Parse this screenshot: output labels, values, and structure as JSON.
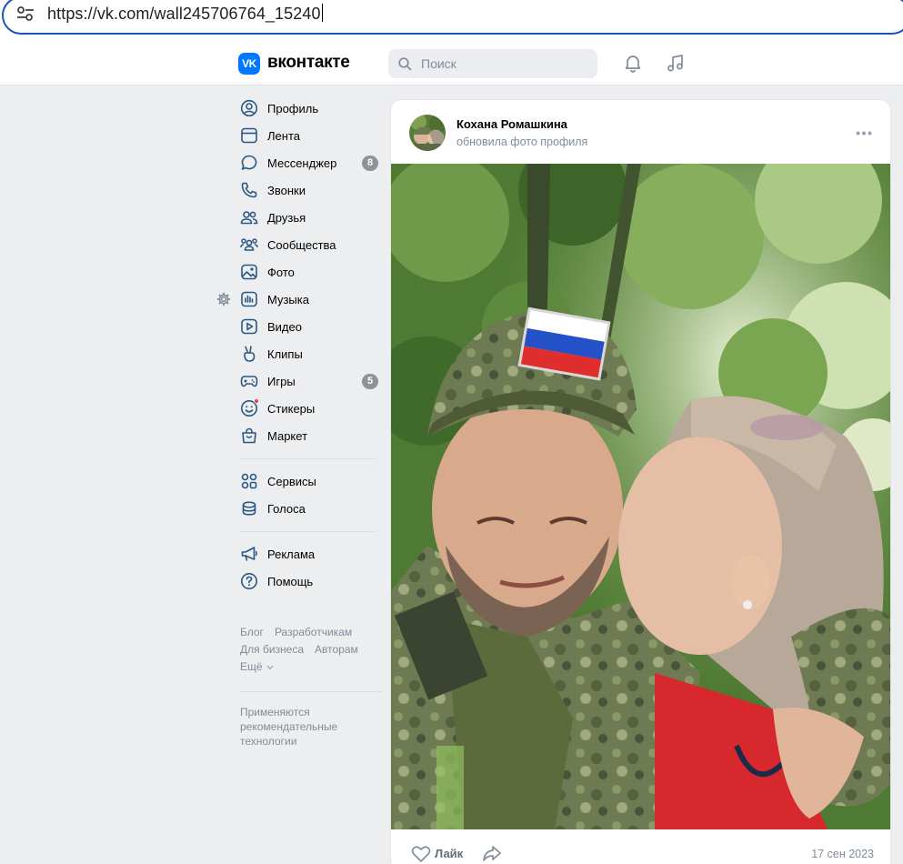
{
  "browser": {
    "url": "https://vk.com/wall245706764_15240"
  },
  "header": {
    "logo_badge": "VK",
    "logo_text": "вконтакте",
    "search_placeholder": "Поиск"
  },
  "sidebar": {
    "items": [
      {
        "label": "Профиль",
        "icon": "profile-icon"
      },
      {
        "label": "Лента",
        "icon": "news-icon"
      },
      {
        "label": "Мессенджер",
        "icon": "messenger-icon",
        "badge": "8"
      },
      {
        "label": "Звонки",
        "icon": "phone-icon"
      },
      {
        "label": "Друзья",
        "icon": "friends-icon"
      },
      {
        "label": "Сообщества",
        "icon": "communities-icon"
      },
      {
        "label": "Фото",
        "icon": "photo-icon"
      },
      {
        "label": "Музыка",
        "icon": "music-icon"
      },
      {
        "label": "Видео",
        "icon": "video-icon"
      },
      {
        "label": "Клипы",
        "icon": "clips-icon"
      },
      {
        "label": "Игры",
        "icon": "games-icon",
        "badge": "5"
      },
      {
        "label": "Стикеры",
        "icon": "stickers-icon"
      },
      {
        "label": "Маркет",
        "icon": "market-icon"
      }
    ],
    "items2": [
      {
        "label": "Сервисы",
        "icon": "services-icon"
      },
      {
        "label": "Голоса",
        "icon": "votes-icon"
      }
    ],
    "items3": [
      {
        "label": "Реклама",
        "icon": "ads-icon"
      },
      {
        "label": "Помощь",
        "icon": "help-icon"
      }
    ],
    "footer": {
      "blog": "Блог",
      "developers": "Разработчикам",
      "business": "Для бизнеса",
      "authors": "Авторам",
      "more": "Ещё"
    },
    "recommendation_note": "Применяются рекомендательные технологии"
  },
  "post": {
    "author": "Кохана Ромашкина",
    "action": "обновила фото профиля",
    "like_label": "Лайк",
    "date": "17 сен 2023"
  },
  "colors": {
    "accent": "#0077ff",
    "badge": "#8f9399",
    "icon": "#2a5885",
    "muted": "#818c99"
  }
}
